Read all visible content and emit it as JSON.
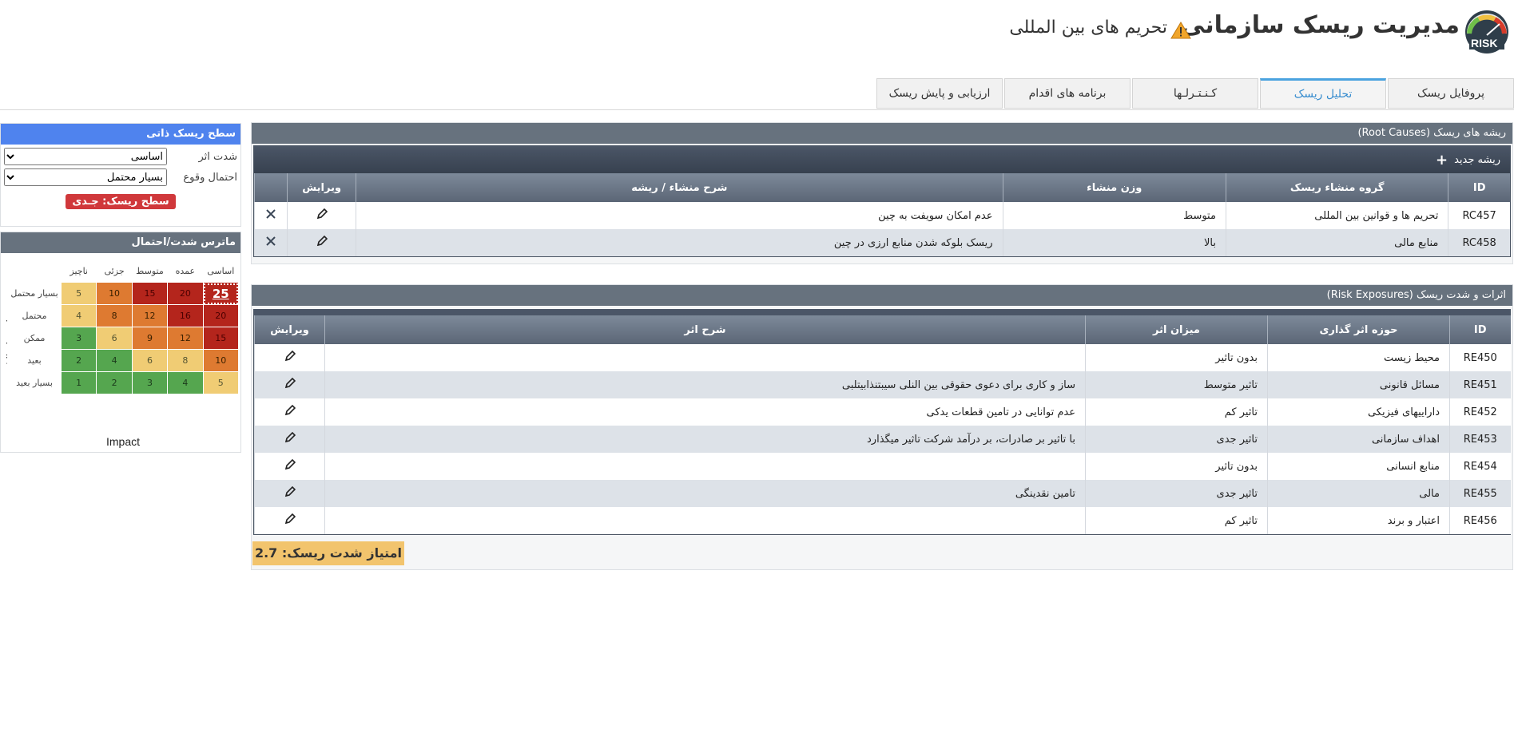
{
  "header": {
    "title": "مدیریت ریسک سازمانی",
    "risk_name": "تحریم های بین المللی",
    "logo_text": "RISK"
  },
  "tabs": [
    {
      "label": "پروفایل ریسک"
    },
    {
      "label": "تحلیل ریسک"
    },
    {
      "label": "کـنـتـرلـها"
    },
    {
      "label": "برنامه های اقدام"
    },
    {
      "label": "ارزیابی و پایش ریسک"
    }
  ],
  "root_causes": {
    "title": "ریشه های ریسک (Root Causes)",
    "new_button": "ریشه جدید",
    "columns": [
      "ID",
      "گروه منشاء ریسک",
      "وزن منشاء",
      "شرح منشاء / ریشه",
      "ویرایش"
    ],
    "rows": [
      {
        "id": "RC457",
        "group": "تحریم ها و قوانین بین المللی",
        "weight": "متوسط",
        "desc": "عدم امکان سویفت به چین"
      },
      {
        "id": "RC458",
        "group": "منابع مالی",
        "weight": "بالا",
        "desc": "ریسک بلوکه شدن منابع ارزی در چین"
      }
    ]
  },
  "exposures": {
    "title": "اثرات و شدت ریسک (Risk Exposures)",
    "columns": [
      "ID",
      "حوزه اثر گذاری",
      "میزان اثر",
      "شرح اثر",
      "ویرایش"
    ],
    "rows": [
      {
        "id": "RE450",
        "area": "محیط زیست",
        "level": "بدون تاثیر",
        "desc": ""
      },
      {
        "id": "RE451",
        "area": "مسائل قانونی",
        "level": "تاثیر متوسط",
        "desc": "ساز و کاری برای دعوی حقوقی بین النلی سیبتنذابیتلبی"
      },
      {
        "id": "RE452",
        "area": "داراییهای فیزیکی",
        "level": "تاثیر کم",
        "desc": "عدم توانایی در تامین قطعات یدکی"
      },
      {
        "id": "RE453",
        "area": "اهداف سازمانی",
        "level": "تاثیر جدی",
        "desc": "با تاثیر بر صادرات، بر درآمد شرکت تاثیر میگذارد"
      },
      {
        "id": "RE454",
        "area": "منابع انسانی",
        "level": "بدون تاثیر",
        "desc": ""
      },
      {
        "id": "RE455",
        "area": "مالی",
        "level": "تاثیر جدی",
        "desc": "تامین نقدینگی"
      },
      {
        "id": "RE456",
        "area": "اعتبار و برند",
        "level": "تاثیر کم",
        "desc": ""
      }
    ],
    "score_label": "امتیاز شدت ریسک: 2.7"
  },
  "inherent": {
    "title": "سطح ریسک ذاتی",
    "impact_label": "شدت اثر",
    "impact_value": "اساسی",
    "likelihood_label": "احتمال وقوع",
    "likelihood_value": "بسیار محتمل",
    "level_badge": "سطح ریسک: جـدی"
  },
  "matrix": {
    "title": "ماترس شدت/احتمال",
    "col_labels": [
      "ناچیز",
      "جزئی",
      "متوسط",
      "عمده",
      "اساسی"
    ],
    "row_labels": [
      "بسیار محتمل",
      "محتمل",
      "ممکن",
      "بعید",
      "بسیار بعید"
    ],
    "values": [
      [
        5,
        10,
        15,
        20,
        25
      ],
      [
        4,
        8,
        12,
        16,
        20
      ],
      [
        3,
        6,
        9,
        12,
        15
      ],
      [
        2,
        4,
        6,
        8,
        10
      ],
      [
        1,
        2,
        3,
        4,
        5
      ]
    ],
    "colors": [
      [
        "y",
        "o",
        "r",
        "r",
        "r"
      ],
      [
        "y",
        "o",
        "o",
        "r",
        "r"
      ],
      [
        "g",
        "y",
        "o",
        "o",
        "r"
      ],
      [
        "g",
        "g",
        "y",
        "y",
        "o"
      ],
      [
        "g",
        "g",
        "g",
        "g",
        "y"
      ]
    ],
    "selected": "25",
    "x_label": "Impact",
    "y_label": "Likehood"
  },
  "colors": {
    "accent": "#4f83ee",
    "header": "#67727e",
    "badge": "#d0383b",
    "score": "#f2c46d"
  }
}
